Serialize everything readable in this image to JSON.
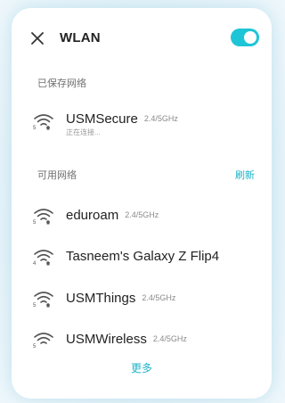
{
  "header": {
    "title": "WLAN",
    "close_icon": "close-icon",
    "wlan_enabled": true,
    "accent_color": "#1ec5d6"
  },
  "saved_section": {
    "label": "已保存网络",
    "networks": [
      {
        "ssid": "USMSecure",
        "band": "2.4/5GHz",
        "status": "正在连接...",
        "wifi_badge": "5",
        "locked": true
      }
    ]
  },
  "available_section": {
    "label": "可用网络",
    "refresh_label": "刷新",
    "networks": [
      {
        "ssid": "eduroam",
        "band": "2.4/5GHz",
        "wifi_badge": "5",
        "locked": true
      },
      {
        "ssid": "Tasneem's Galaxy Z Flip4",
        "band": "",
        "wifi_badge": "4",
        "locked": true
      },
      {
        "ssid": "USMThings",
        "band": "2.4/5GHz",
        "wifi_badge": "5",
        "locked": true
      },
      {
        "ssid": "USMWireless",
        "band": "2.4/5GHz",
        "wifi_badge": "5",
        "locked": false
      }
    ]
  },
  "more_label": "更多"
}
